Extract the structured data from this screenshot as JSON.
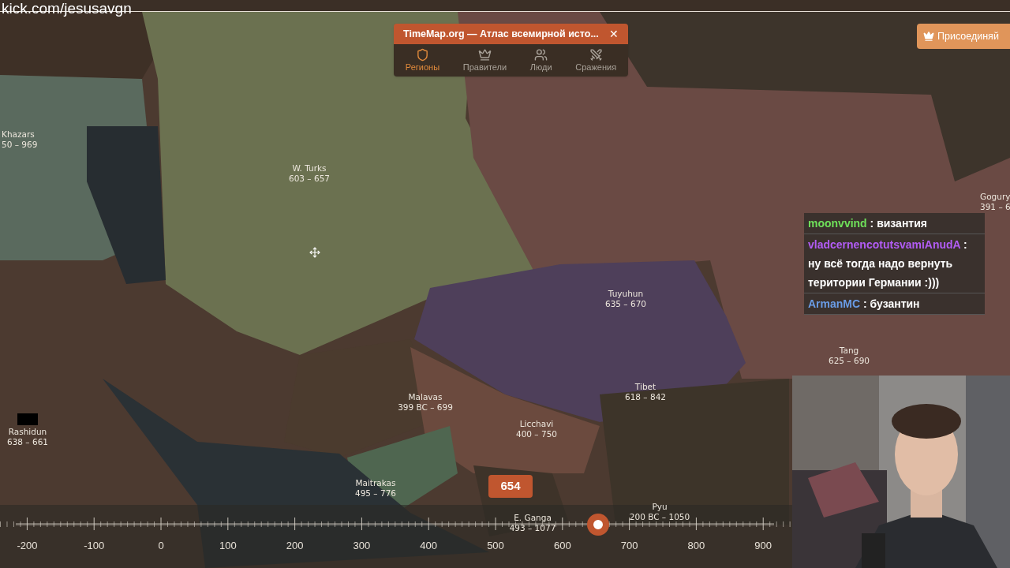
{
  "stream_overlay": {
    "channel_url": "kick.com/jesusavgn"
  },
  "site_panel": {
    "title": "TimeMap.org — Атлас всемирной исто...",
    "close": "✕",
    "tabs": [
      {
        "kind": "regions",
        "label": "Регионы",
        "selected": true
      },
      {
        "kind": "rulers",
        "label": "Правители",
        "selected": false
      },
      {
        "kind": "people",
        "label": "Люди",
        "selected": false
      },
      {
        "kind": "battles",
        "label": "Сражения",
        "selected": false
      }
    ]
  },
  "join_button": {
    "label": "Присоединяй"
  },
  "map_labels": [
    {
      "name": "Khazars",
      "years": "50 – 969"
    },
    {
      "name": "W. Turks",
      "years": "603 – 657"
    },
    {
      "name": "Tuyuhun",
      "years": "635 – 670"
    },
    {
      "name": "Tang",
      "years": "625 – 690"
    },
    {
      "name": "Tibet",
      "years": "618 – 842"
    },
    {
      "name": "Malavas",
      "years": "399 BC – 699"
    },
    {
      "name": "Licchavi",
      "years": "400 – 750"
    },
    {
      "name": "Rashidun",
      "years": "638 – 661"
    },
    {
      "name": "Maitrakas",
      "years": "495 – 776"
    },
    {
      "name": "E. Ganga",
      "years": "493 – 1077"
    },
    {
      "name": "Pyu",
      "years": "200 BC – 1050"
    },
    {
      "name": "Gogury",
      "years": "391 – 6"
    }
  ],
  "chat": [
    {
      "user": "moonvvind",
      "color": "#6fe05a",
      "separator": ":",
      "text": "византия"
    },
    {
      "user": "vladcernencotutsvamiAnudA",
      "color": "#b25cf5",
      "separator": ":",
      "text": "ну всё тогда надо вернуть територии Германии :)))"
    },
    {
      "user": "ArmanMC",
      "color": "#6a9ce6",
      "separator": ":",
      "text": "бузантин"
    }
  ],
  "timeline": {
    "year": "654",
    "level": 0.776,
    "ticks": [
      "-200",
      "-100",
      "0",
      "100",
      "200",
      "300",
      "400",
      "500",
      "600",
      "700",
      "800",
      "900"
    ]
  }
}
